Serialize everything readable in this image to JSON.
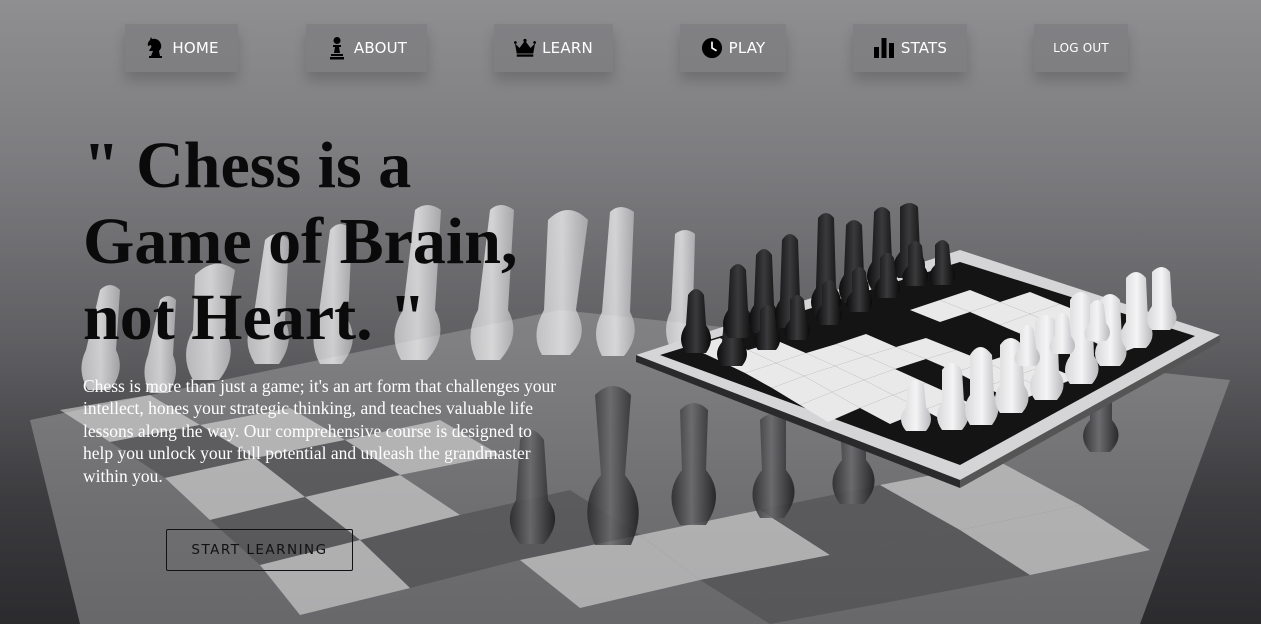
{
  "nav": {
    "items": [
      {
        "label": "HOME",
        "icon": "chess-knight-icon"
      },
      {
        "label": "ABOUT",
        "icon": "chess-pawn-icon"
      },
      {
        "label": "LEARN",
        "icon": "crown-icon"
      },
      {
        "label": "PLAY",
        "icon": "clock-icon"
      },
      {
        "label": "STATS",
        "icon": "bar-chart-icon"
      }
    ],
    "logout_label": "LOG OUT"
  },
  "hero": {
    "headline_line1": "\" Chess is a",
    "headline_line2": "Game of Brain,",
    "headline_line3": "not Heart. \"",
    "description": "Chess is more than just a game; it's an art form that challenges your intellect, hones your strategic thinking, and teaches valuable life lessons along the way. Our comprehensive course is designed to help you unlock your full potential and unleash the grandmaster within you.",
    "cta_label": "START LEARNING"
  },
  "colors": {
    "nav_text": "#ffffff",
    "headline": "#0a0a0a",
    "description_text": "#ffffff",
    "cta_border": "#111111"
  }
}
